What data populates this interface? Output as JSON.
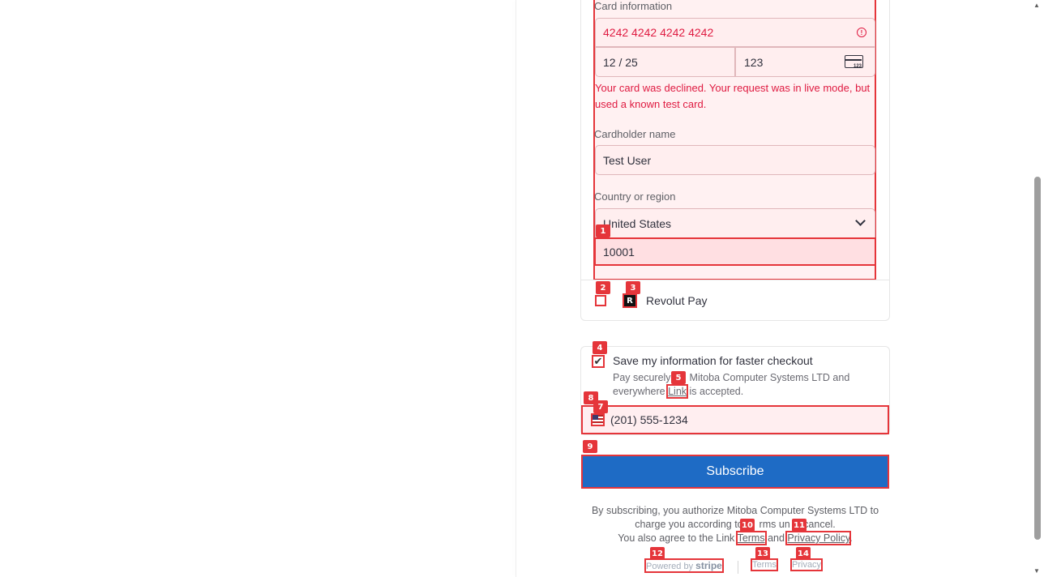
{
  "card_section": {
    "card_info_label": "Card information",
    "card_number": "4242 4242 4242 4242",
    "expiry": "12 / 25",
    "cvc": "123",
    "error_message": "Your card was declined. Your request was in live mode, but used a known test card.",
    "cardholder_label": "Cardholder name",
    "cardholder_value": "Test User",
    "country_label": "Country or region",
    "country_value": "United States",
    "zip_value": "10001"
  },
  "revolut": {
    "label": "Revolut Pay",
    "logo_letter": "R"
  },
  "link_save": {
    "title": "Save my information for faster checkout",
    "desc_1": "Pay securely",
    "desc_2": "Mitoba Computer Systems LTD and",
    "desc_3": "everywhere",
    "link_text": "Link",
    "desc_4": "is accepted.",
    "phone": "(201) 555-1234",
    "checked_mark": "✔"
  },
  "subscribe_label": "Subscribe",
  "legal": {
    "line1": "By subscribing, you authorize Mitoba Computer Systems LTD to",
    "line2a": "charge you according to th",
    "line2b": "rms un",
    "line2c": "u cancel.",
    "line3a": "You also agree to the Link",
    "terms_link": "Terms",
    "and": "and",
    "privacy_link": "Privacy Policy"
  },
  "footer": {
    "powered_by": "Powered by",
    "stripe": "stripe",
    "terms": "Terms",
    "privacy": "Privacy"
  },
  "badges": [
    "1",
    "2",
    "3",
    "4",
    "5",
    "7",
    "8",
    "9",
    "10",
    "11",
    "12",
    "13",
    "14"
  ],
  "colors": {
    "error": "#df1b41",
    "highlight": "#e5353a",
    "button": "#1e6bc5"
  },
  "icons": [
    "error-info-icon",
    "card-cvc-icon",
    "chevron-down-icon",
    "us-flag-icon",
    "checkmark-icon"
  ]
}
